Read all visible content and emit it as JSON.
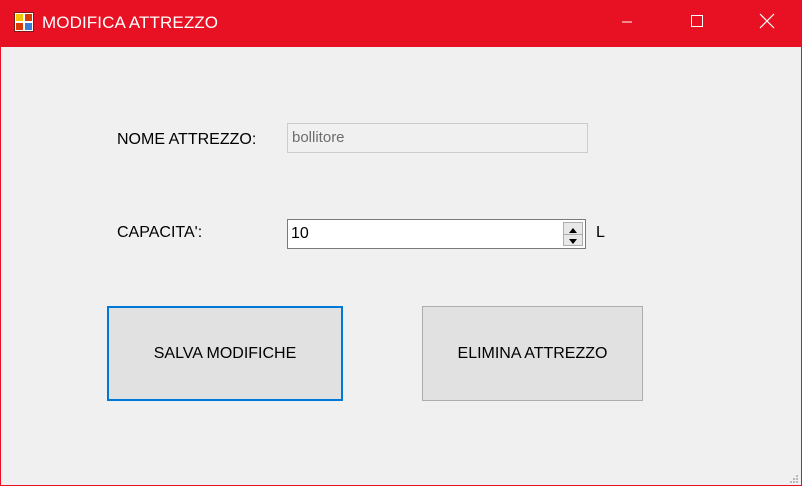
{
  "window": {
    "title": "MODIFICA ATTREZZO",
    "accent_color": "#e81123",
    "controls": {
      "minimize_icon": "minimize-icon",
      "maximize_icon": "maximize-icon",
      "close_icon": "close-icon"
    }
  },
  "form": {
    "nome": {
      "label": "NOME ATTREZZO:",
      "value": "bollitore"
    },
    "capacita": {
      "label": "CAPACITA':",
      "value": "10",
      "unit": "L"
    }
  },
  "buttons": {
    "save_label": "SALVA MODIFICHE",
    "delete_label": "ELIMINA ATTREZZO"
  }
}
